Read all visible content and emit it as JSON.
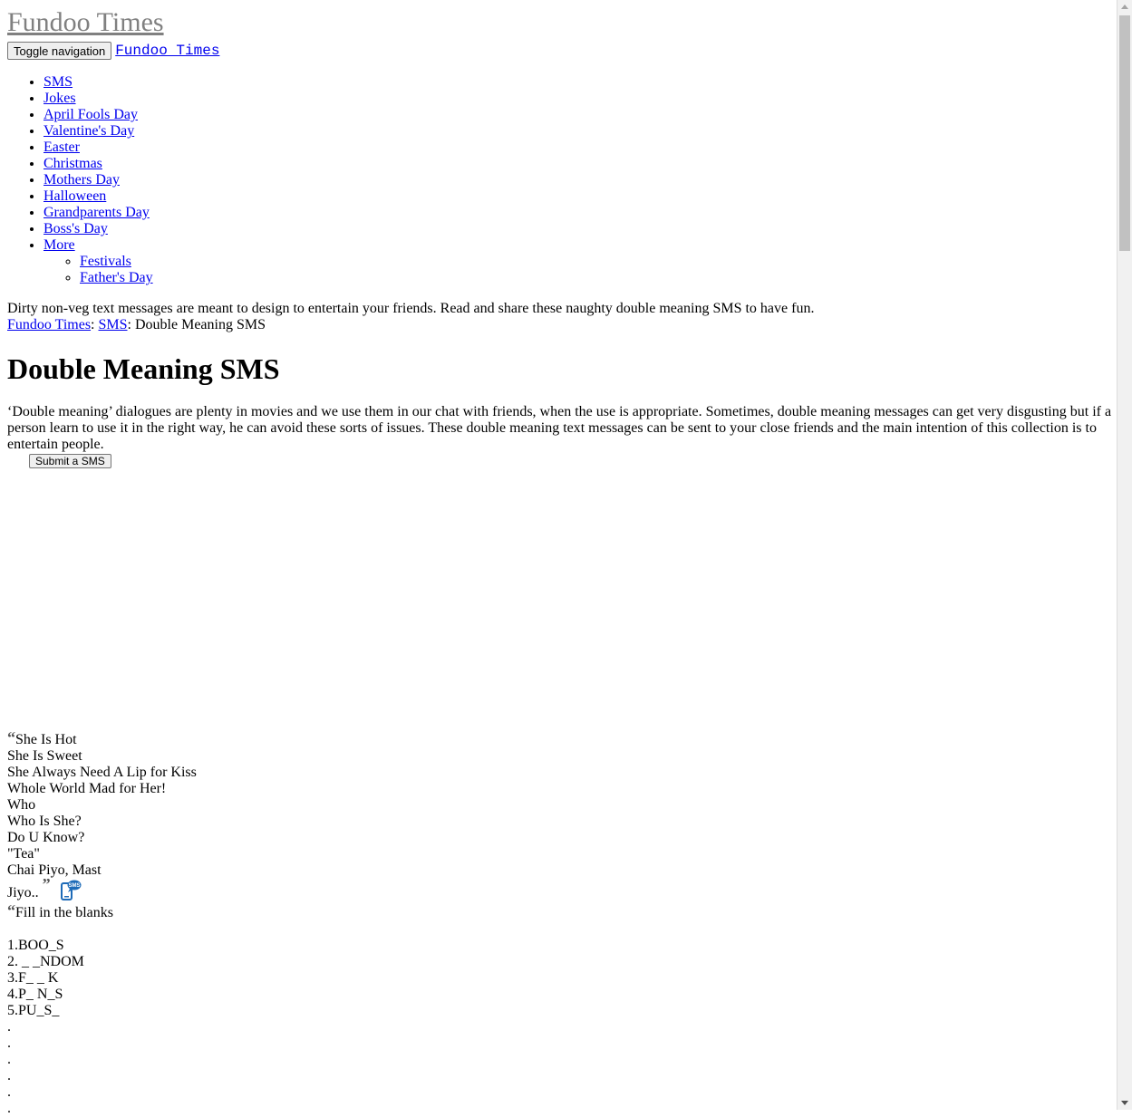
{
  "site": {
    "brand": "Fundoo Times",
    "brand_short": "Fundoo Times"
  },
  "navbar": {
    "toggle_label": "Toggle navigation"
  },
  "nav": {
    "items": [
      "SMS",
      "Jokes",
      "April Fools Day",
      "Valentine's Day",
      "Easter",
      "Christmas",
      "Mothers Day",
      "Halloween",
      "Grandparents Day",
      "Boss's Day"
    ],
    "more_label": "More",
    "more_items": [
      "Festivals",
      "Father's Day"
    ]
  },
  "lead": "Dirty non-veg text messages are meant to design to entertain your friends. Read and share these naughty double meaning SMS to have fun.",
  "breadcrumb": {
    "home": "Fundoo Times",
    "sep": ": ",
    "section": "SMS",
    "current": "Double Meaning SMS"
  },
  "title": "Double Meaning SMS",
  "intro": "‘Double meaning’ dialogues are plenty in movies and we use them in our chat with friends, when the use is appropriate. Sometimes, double meaning messages can get very disgusting but if a person learn to use it in the right way, he can avoid these sorts of issues. These double meaning text messages can be sent to your close friends and the main intention of this collection is to entertain people.",
  "submit_label": "Submit a SMS",
  "messages": [
    {
      "lines": [
        "She Is Hot",
        "She Is Sweet",
        "She Always Need A Lip for Kiss",
        "Whole World Mad for Her!",
        "Who",
        "Who Is She?",
        "Do U Know?",
        "\"Tea\"",
        "Chai Piyo, Mast",
        "Jiyo.."
      ]
    },
    {
      "lines": [
        "Fill in the blanks",
        "",
        "1.BOO_S",
        "2. _ _NDOM",
        "3.F_ _ K",
        "4.P_ N_S",
        "5.PU_S_",
        ".",
        ".",
        ".",
        ".",
        ".",
        "."
      ]
    }
  ],
  "icons": {
    "open_quote": "“",
    "close_quote": "”",
    "sms_icon": "sms-phone-icon"
  },
  "colors": {
    "link": "#0000ee",
    "brand_faded": "#808080",
    "icon_blue": "#1e6bb8"
  }
}
